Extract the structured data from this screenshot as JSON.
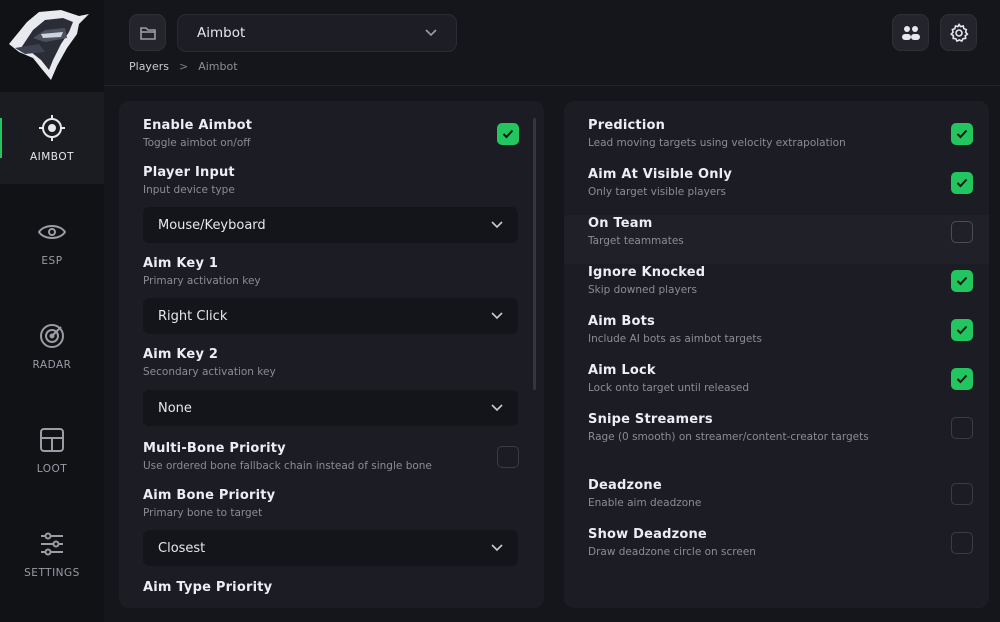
{
  "colors": {
    "accent": "#22c55e",
    "background": "#15161c",
    "panel": "#1c1d24",
    "sidebar": "#111216"
  },
  "sidebar": {
    "items": [
      {
        "label": "AIMBOT",
        "icon": "crosshair-icon",
        "active": true
      },
      {
        "label": "ESP",
        "icon": "eye-icon",
        "active": false
      },
      {
        "label": "RADAR",
        "icon": "radar-icon",
        "active": false
      },
      {
        "label": "LOOT",
        "icon": "loot-grid-icon",
        "active": false
      },
      {
        "label": "SETTINGS",
        "icon": "sliders-icon",
        "active": false
      }
    ]
  },
  "header": {
    "profile_select": "Aimbot",
    "breadcrumb": {
      "root": "Players",
      "sep": ">",
      "current": "Aimbot"
    },
    "icons": [
      "folder-icon",
      "users-icon",
      "gear-icon"
    ]
  },
  "left_panel": {
    "enable": {
      "title": "Enable Aimbot",
      "desc": "Toggle aimbot on/off",
      "checked": true
    },
    "player_input": {
      "title": "Player Input",
      "desc": "Input device type",
      "value": "Mouse/Keyboard"
    },
    "aim_key_1": {
      "title": "Aim Key 1",
      "desc": "Primary activation key",
      "value": "Right Click"
    },
    "aim_key_2": {
      "title": "Aim Key 2",
      "desc": "Secondary activation key",
      "value": "None"
    },
    "multi_bone": {
      "title": "Multi-Bone Priority",
      "desc": "Use ordered bone fallback chain instead of single bone",
      "checked": false
    },
    "aim_bone": {
      "title": "Aim Bone Priority",
      "desc": "Primary bone to target",
      "value": "Closest"
    },
    "aim_type": {
      "title": "Aim Type Priority"
    }
  },
  "right_panel": {
    "items": [
      {
        "title": "Prediction",
        "desc": "Lead moving targets using velocity extrapolation",
        "checked": true
      },
      {
        "title": "Aim At Visible Only",
        "desc": "Only target visible players",
        "checked": true
      },
      {
        "title": "On Team",
        "desc": "Target teammates",
        "checked": false
      },
      {
        "title": "Ignore Knocked",
        "desc": "Skip downed players",
        "checked": true
      },
      {
        "title": "Aim Bots",
        "desc": "Include AI bots as aimbot targets",
        "checked": true
      },
      {
        "title": "Aim Lock",
        "desc": "Lock onto target until released",
        "checked": true
      },
      {
        "title": "Snipe Streamers",
        "desc": "Rage (0 smooth) on streamer/content-creator targets",
        "checked": false
      },
      {
        "title": "Deadzone",
        "desc": "Enable aim deadzone",
        "checked": false
      },
      {
        "title": "Show Deadzone",
        "desc": "Draw deadzone circle on screen",
        "checked": false
      }
    ]
  }
}
